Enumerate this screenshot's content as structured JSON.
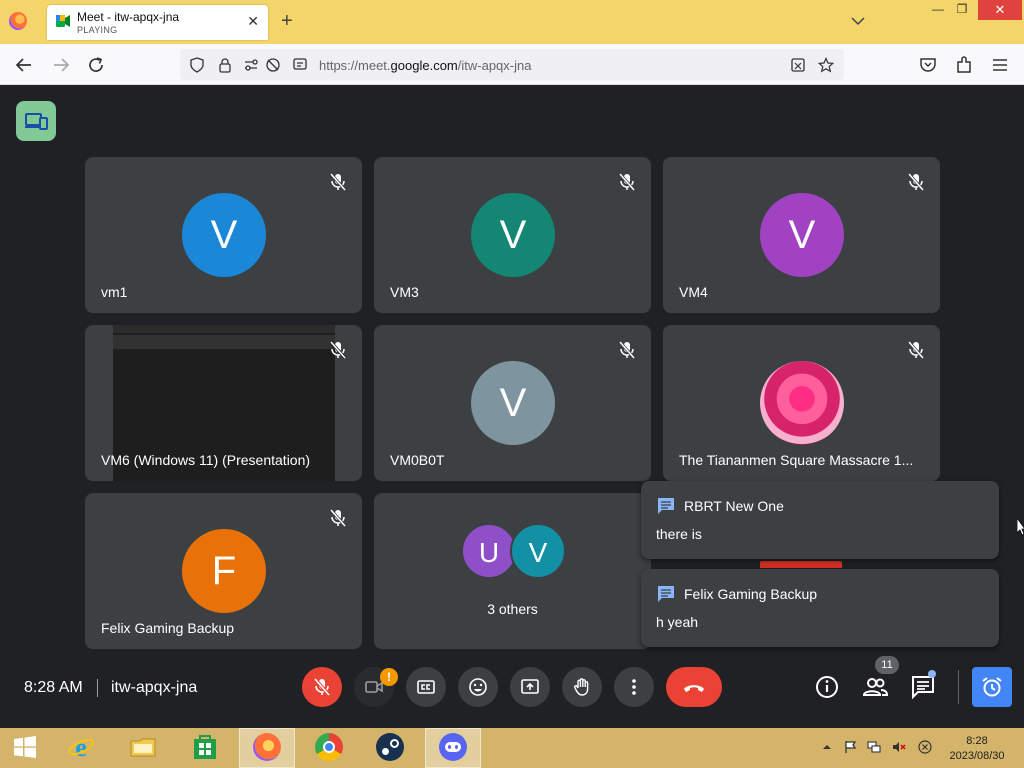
{
  "browser": {
    "tab": {
      "title": "Meet - itw-apqx-jna",
      "subtitle": "PLAYING"
    },
    "url": {
      "prefix": "https://meet.",
      "domain": "google.com",
      "path": "/itw-apqx-jna"
    }
  },
  "tiles": [
    {
      "name": "vm1",
      "initial": "V",
      "avatar_color": "#1a88d6"
    },
    {
      "name": "VM3",
      "initial": "V",
      "avatar_color": "#138674"
    },
    {
      "name": "VM4",
      "initial": "V",
      "avatar_color": "#a142c3"
    },
    {
      "name": "VM6 (Windows 11) (Presentation)"
    },
    {
      "name": "VM0B0T",
      "initial": "V",
      "avatar_color": "#7e95a0"
    },
    {
      "name": "The Tiananmen Square Massacre 1..."
    },
    {
      "name": "Felix Gaming Backup",
      "initial": "F",
      "avatar_color": "#e8710a"
    },
    {
      "others": [
        {
          "initial": "U",
          "color": "#8e4fc8"
        },
        {
          "initial": "V",
          "color": "#1291a6"
        }
      ],
      "label": "3 others"
    }
  ],
  "chat_toasts": [
    {
      "sender": "RBRT New One",
      "message": "there is"
    },
    {
      "sender": "Felix Gaming Backup",
      "message": "h yeah"
    }
  ],
  "meeting": {
    "time": "8:28 AM",
    "code": "itw-apqx-jna",
    "participant_count": "11",
    "camera_warning": "!"
  },
  "taskbar": {
    "time": "8:28",
    "date": "2023/08/30"
  },
  "colors": {
    "accent": "#4285f4",
    "danger": "#ea4335",
    "tile": "#3c4043",
    "background": "#202124"
  }
}
